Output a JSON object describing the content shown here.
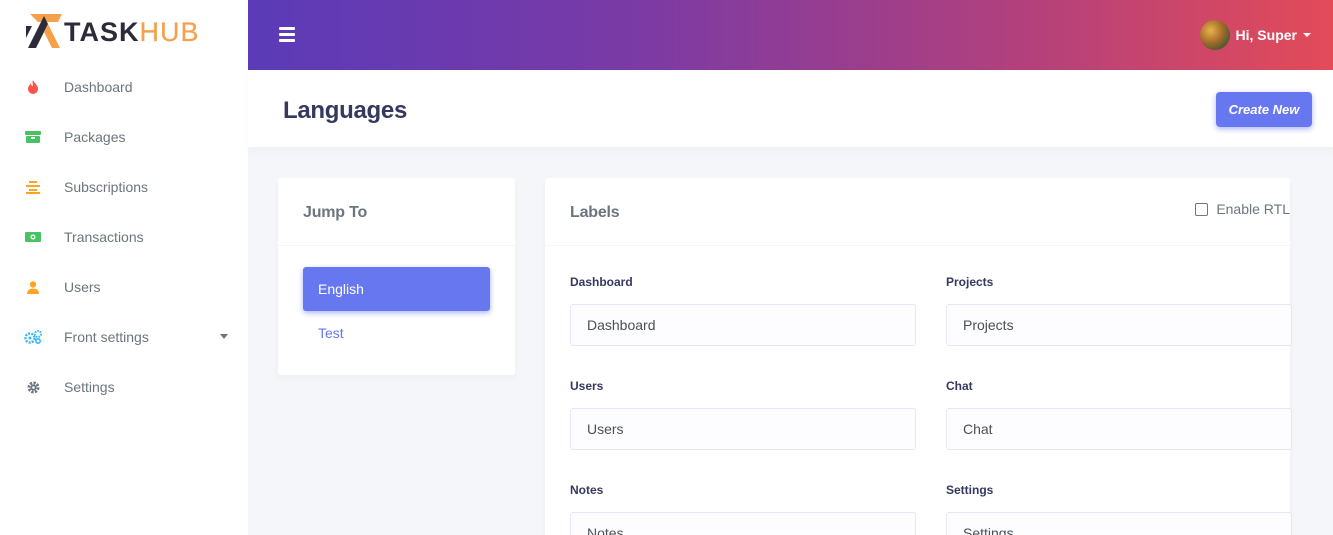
{
  "brand": {
    "task": "TASK",
    "hub": "HUB"
  },
  "sidebar": {
    "items": [
      {
        "label": "Dashboard",
        "icon": "fire-icon",
        "color": "#fc544b"
      },
      {
        "label": "Packages",
        "icon": "box-icon",
        "color": "#47c363"
      },
      {
        "label": "Subscriptions",
        "icon": "list-icon",
        "color": "#ffa426"
      },
      {
        "label": "Transactions",
        "icon": "money-icon",
        "color": "#47c363"
      },
      {
        "label": "Users",
        "icon": "user-icon",
        "color": "#ffa426"
      },
      {
        "label": "Front settings",
        "icon": "cogs-icon",
        "color": "#3abaf4"
      },
      {
        "label": "Settings",
        "icon": "gear-icon",
        "color": "#6c757d"
      }
    ]
  },
  "topbar": {
    "user_name": "Hi, Super"
  },
  "header": {
    "title": "Languages",
    "create_label": "Create New"
  },
  "jump": {
    "title": "Jump To",
    "languages": [
      "English",
      "Test"
    ]
  },
  "labels": {
    "title": "Labels",
    "rtl_label": "Enable RTL",
    "fields": [
      {
        "label": "Dashboard",
        "value": "Dashboard"
      },
      {
        "label": "Projects",
        "value": "Projects"
      },
      {
        "label": "Users",
        "value": "Users"
      },
      {
        "label": "Chat",
        "value": "Chat"
      },
      {
        "label": "Notes",
        "value": "Notes"
      },
      {
        "label": "Settings",
        "value": "Settings"
      }
    ]
  },
  "colors": {
    "primary": "#6777ef",
    "text": "#34395e",
    "muted": "#6c757d"
  }
}
